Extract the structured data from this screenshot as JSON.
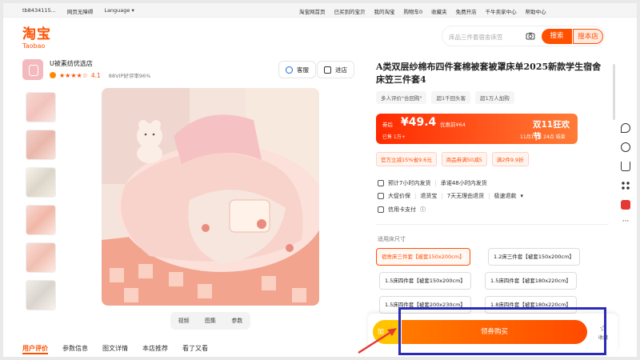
{
  "topbar": {
    "left": [
      "tb8434115...",
      "网页无障碍",
      "Language"
    ],
    "right": [
      "淘宝网首页",
      "已买到的宝贝",
      "我的淘宝",
      "购物车0",
      "收藏夹",
      "免费开店",
      "千牛卖家中心",
      "帮助中心"
    ]
  },
  "logo": {
    "cn": "淘宝",
    "en": "Taobao"
  },
  "search": {
    "placeholder": "床品三件套宿舍床笠",
    "search_label": "搜索",
    "shop_label": "搜本店"
  },
  "shop": {
    "name": "U被素纺优选店",
    "rating": "4.1",
    "stars": "★★★★☆",
    "vip": "88VIP好评率96%",
    "service_label": "客服",
    "enter_label": "进店"
  },
  "image_tabs": [
    "视频",
    "图集",
    "参数"
  ],
  "bottom_tabs": [
    "用户评价",
    "参数信息",
    "图文详情",
    "本店推荐",
    "看了又看"
  ],
  "product": {
    "title": "A类双层纱棉布四件套棉被套被罩床单2025新款学生宿舍床笠三件套4",
    "tags": [
      "多人评价\"合回购\"",
      "超1千回头客",
      "超1万人加购"
    ],
    "price_label": "券后",
    "price": "¥49.4",
    "orig": "优惠前¥64",
    "sold": "已售 1万+",
    "event": "双11狂欢节",
    "event_date": "11月14日 24点 结束",
    "coupons": [
      "官方立减15%省9.6元",
      "商品券满50减5",
      "满2件9.9折"
    ],
    "services": [
      [
        "预计7小时内发货",
        "承诺48小时内发货"
      ],
      [
        "大促价保",
        "退货宝",
        "7天无理由退货",
        "极速退款"
      ],
      [
        "信用卡支付"
      ]
    ],
    "size_label": "适用床尺寸",
    "options": [
      "宿舍床三件套【被套150x200cm】",
      "1.2床三件套【被套150x200cm】",
      "1.5床四件套【被套150x200cm】",
      "1.5床四件套【被套180x220cm】",
      "1.5床四件套【被套200x230cm】",
      "1.8床四件套【被套180x220cm】"
    ],
    "cart_label": "加",
    "buy_label": "领券购买",
    "fav_label": "收藏"
  },
  "colors": {
    "accent": "#ff5000",
    "highlight": "#2b2bb8"
  }
}
